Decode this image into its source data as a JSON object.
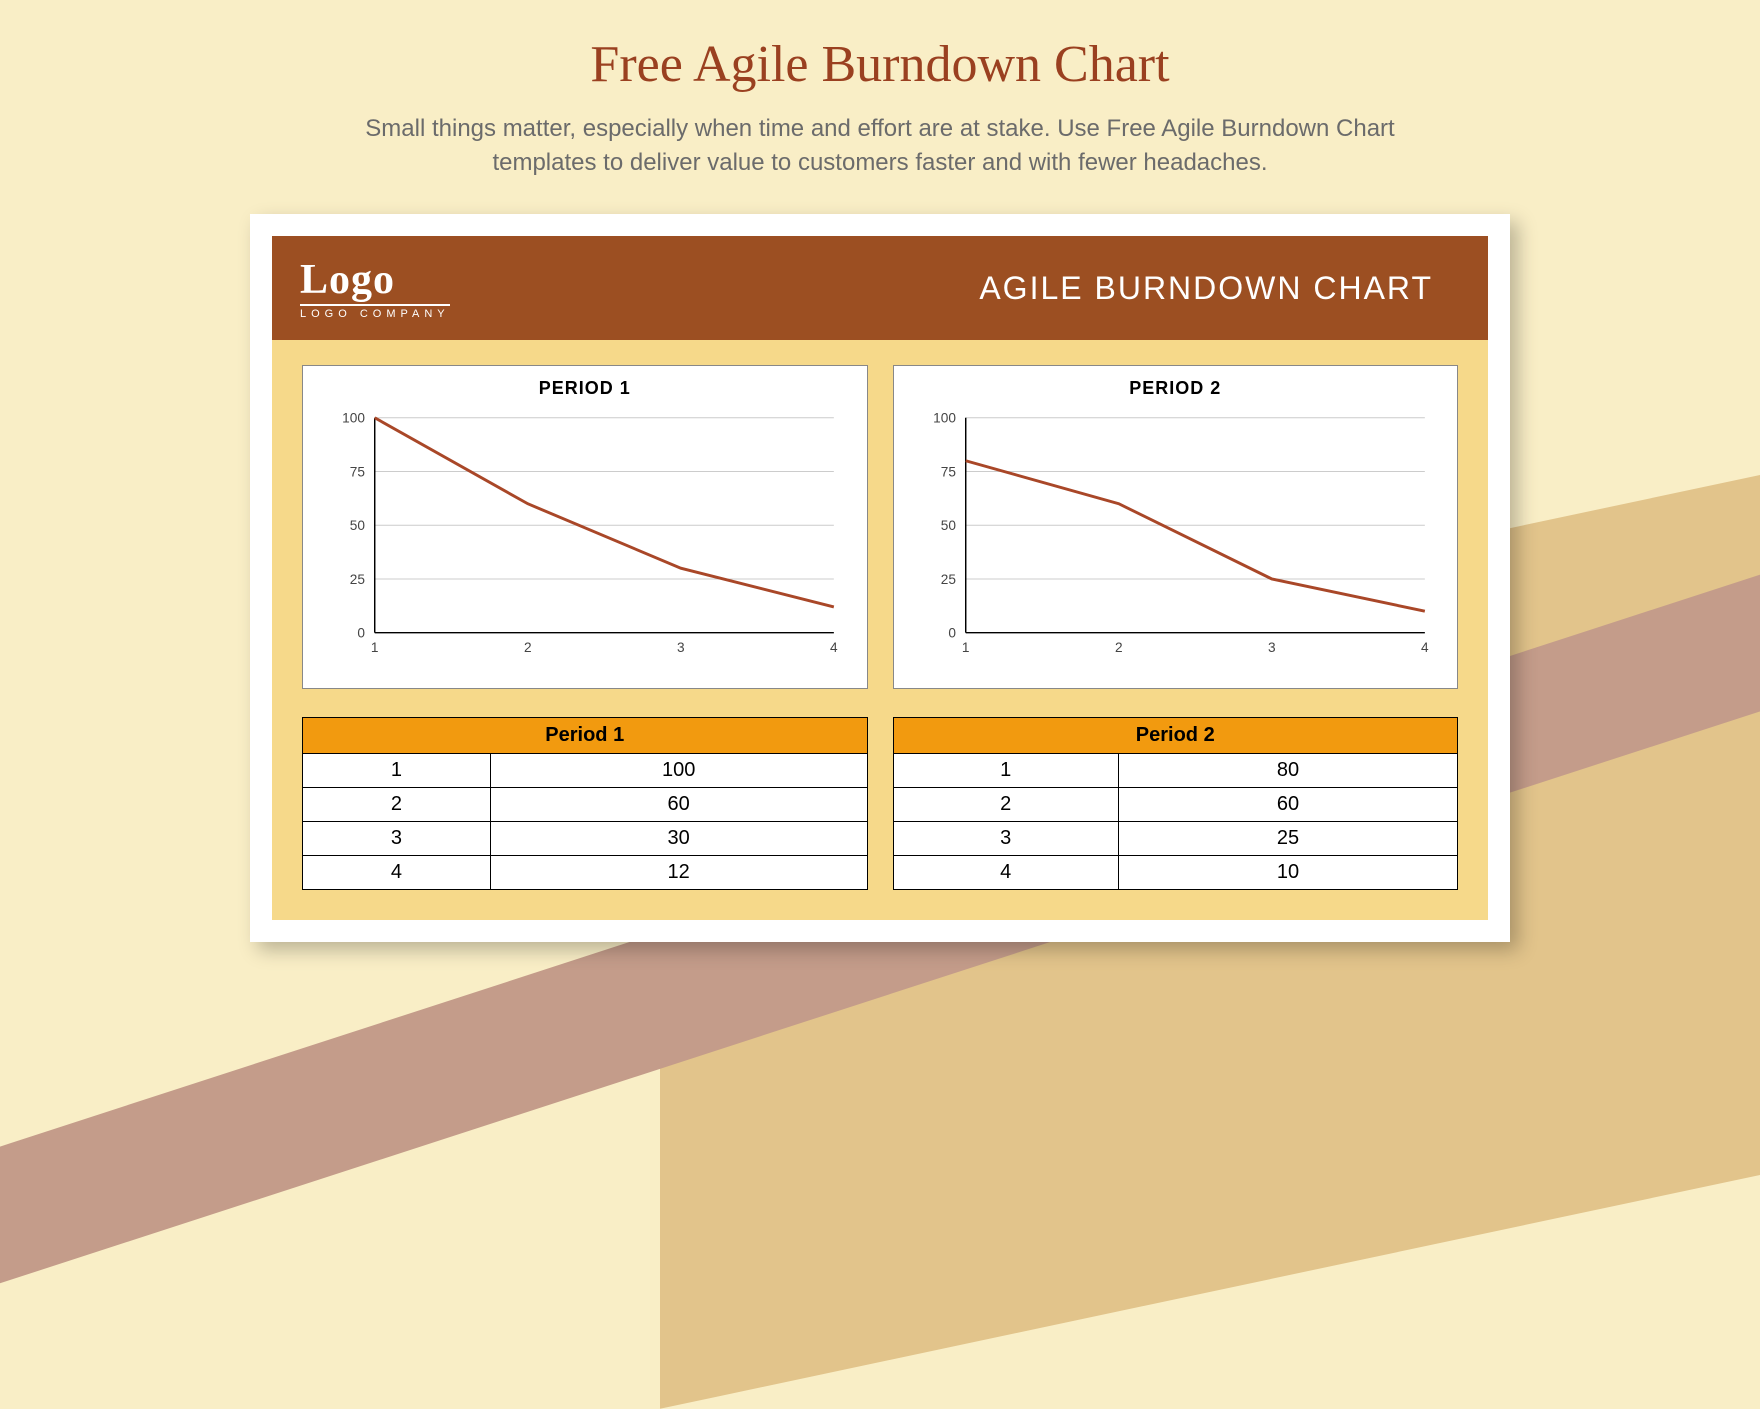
{
  "page": {
    "title": "Free Agile Burndown Chart",
    "subtitle": "Small things matter, especially when time and effort are at stake. Use Free Agile Burndown Chart templates to deliver value to customers faster and with fewer headaches."
  },
  "header": {
    "logo_text": "Logo",
    "logo_company": "Logo Company",
    "title": "AGILE BURNDOWN CHART"
  },
  "chart_data": [
    {
      "type": "line",
      "title": "PERIOD 1",
      "categories": [
        1,
        2,
        3,
        4
      ],
      "values": [
        100,
        60,
        30,
        12
      ],
      "ylim": [
        0,
        100
      ],
      "yticks": [
        0,
        25,
        50,
        75,
        100
      ],
      "xlabel": "",
      "ylabel": ""
    },
    {
      "type": "line",
      "title": "PERIOD 2",
      "categories": [
        1,
        2,
        3,
        4
      ],
      "values": [
        80,
        60,
        25,
        10
      ],
      "ylim": [
        0,
        100
      ],
      "yticks": [
        0,
        25,
        50,
        75,
        100
      ],
      "xlabel": "",
      "ylabel": ""
    }
  ],
  "tables": [
    {
      "header": "Period 1",
      "rows": [
        {
          "k": "1",
          "v": "100"
        },
        {
          "k": "2",
          "v": "60"
        },
        {
          "k": "3",
          "v": "30"
        },
        {
          "k": "4",
          "v": "12"
        }
      ]
    },
    {
      "header": "Period 2",
      "rows": [
        {
          "k": "1",
          "v": "80"
        },
        {
          "k": "2",
          "v": "60"
        },
        {
          "k": "3",
          "v": "25"
        },
        {
          "k": "4",
          "v": "10"
        }
      ]
    }
  ]
}
